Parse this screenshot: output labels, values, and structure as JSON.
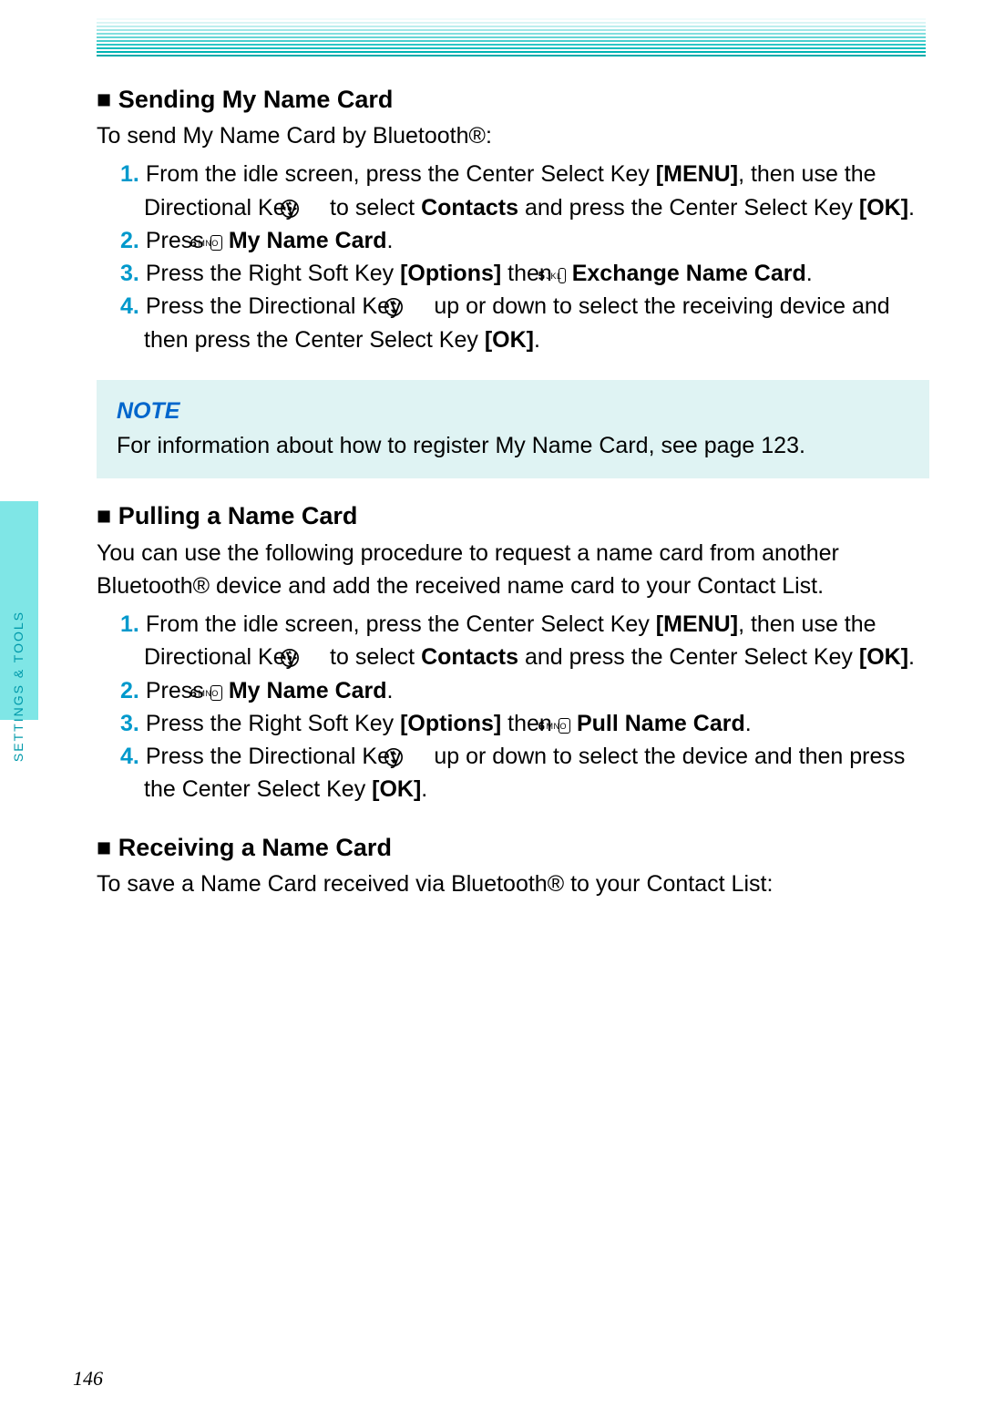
{
  "sidebar_label": "SETTINGS & TOOLS",
  "page_number": "146",
  "sections": [
    {
      "title": "■  Sending My Name Card",
      "intro": "To send My Name Card by Bluetooth®:",
      "steps": [
        {
          "num": "1.",
          "pre": "From the idle screen, press the Center Select Key ",
          "b1": "[MENU]",
          "mid1": ", then use the Directional Key ",
          "icon": "dpad4",
          "mid2": " to select ",
          "b2": "Contacts",
          "mid3": " and press the Center Select Key ",
          "b3": "[OK]",
          "post": "."
        },
        {
          "num": "2.",
          "pre": "Press ",
          "icon": "6mno",
          "mid1": " ",
          "b1": "My Name Card",
          "post": "."
        },
        {
          "num": "3.",
          "pre": "Press the Right Soft Key ",
          "b1": "[Options]",
          "mid1": " then ",
          "icon": "5jkl",
          "mid2": " ",
          "b2": "Exchange Name Card",
          "post": "."
        },
        {
          "num": "4.",
          "pre": "Press the Directional Key ",
          "icon": "dpad_ud",
          "mid1": " up or down to select the receiving device and then press the Center Select Key ",
          "b1": "[OK]",
          "post": "."
        }
      ],
      "note_label": "NOTE",
      "note_text": "For information about how to register My Name Card, see page 123."
    },
    {
      "title": "■  Pulling a Name Card",
      "intro": "You can use the following procedure to request a name card from another Bluetooth® device and add the received name card to your Contact List.",
      "steps": [
        {
          "num": "1.",
          "pre": "From the idle screen, press the Center Select Key ",
          "b1": "[MENU]",
          "mid1": ", then use the Directional Key ",
          "icon": "dpad4",
          "mid2": " to select ",
          "b2": "Contacts",
          "mid3": " and press the Center Select Key ",
          "b3": "[OK]",
          "post": "."
        },
        {
          "num": "2.",
          "pre": "Press ",
          "icon": "6mno",
          "mid1": " ",
          "b1": "My Name Card",
          "post": "."
        },
        {
          "num": "3.",
          "pre": "Press the Right Soft Key ",
          "b1": "[Options]",
          "mid1": " then ",
          "icon": "6mno",
          "mid2": " ",
          "b2": "Pull Name Card",
          "post": "."
        },
        {
          "num": "4.",
          "pre": "Press the Directional Key ",
          "icon": "dpad_ud",
          "mid1": " up or down to select the device and then press the Center Select Key ",
          "b1": "[OK]",
          "post": "."
        }
      ]
    },
    {
      "title": "■  Receiving a Name Card",
      "intro": "To save a Name Card received via Bluetooth® to your Contact List:"
    }
  ]
}
